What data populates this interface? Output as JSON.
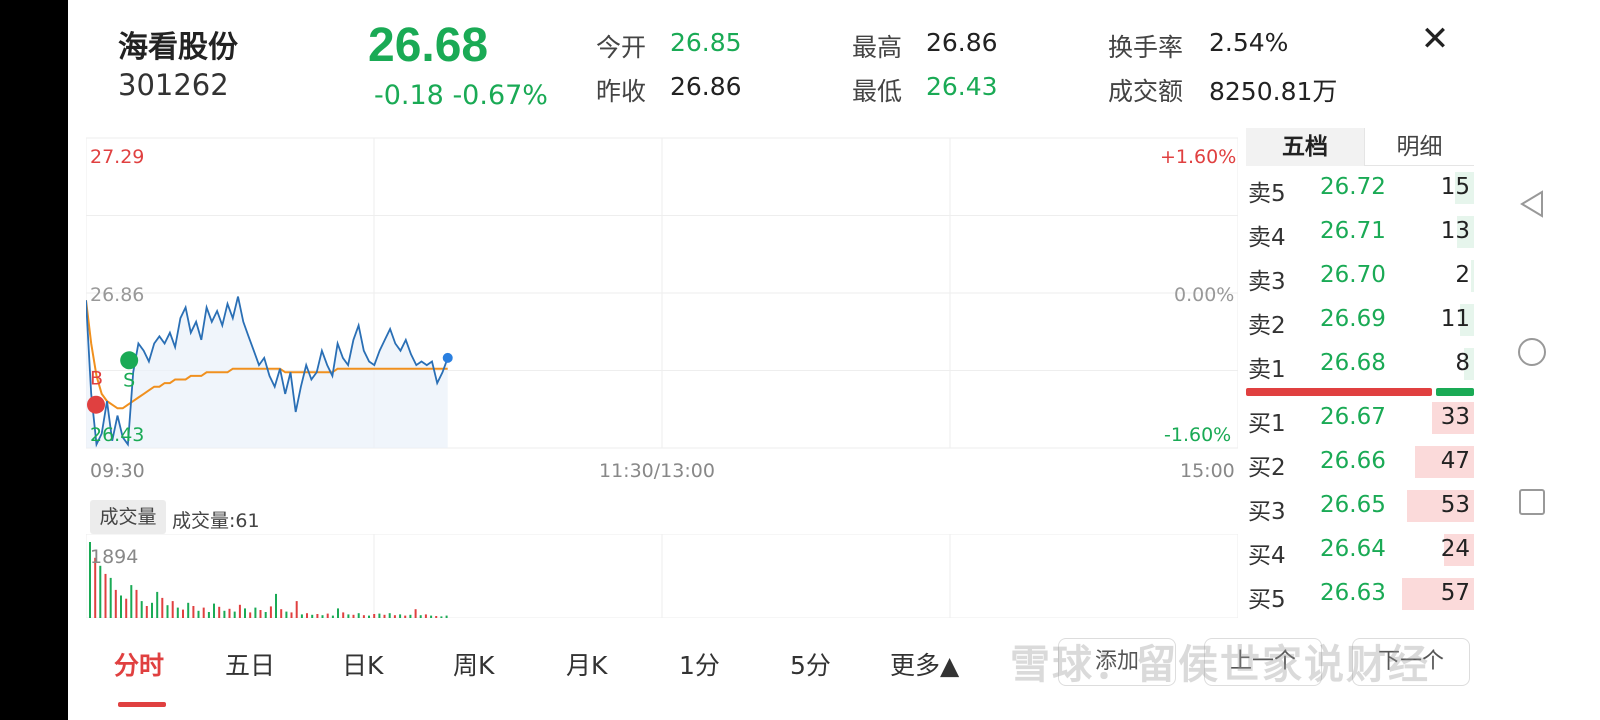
{
  "header": {
    "stock_name": "海看股份",
    "stock_code": "301262",
    "price": "26.68",
    "change": "-0.18 -0.67%",
    "stats": [
      {
        "label": "今开",
        "value": "26.85",
        "color": "#1aaa55"
      },
      {
        "label": "昨收",
        "value": "26.86",
        "color": "#222222"
      },
      {
        "label": "最高",
        "value": "26.86",
        "color": "#222222"
      },
      {
        "label": "最低",
        "value": "26.43",
        "color": "#1aaa55"
      },
      {
        "label": "换手率",
        "value": "2.54%",
        "color": "#222222"
      },
      {
        "label": "成交额",
        "value": "8250.81万",
        "color": "#222222"
      }
    ],
    "close_icon": "close-icon"
  },
  "chart": {
    "y_top_label": "27.29",
    "y_mid_label": "26.86",
    "y_bottom_label": "26.43",
    "pct_top": "+1.60%",
    "pct_mid": "0.00%",
    "pct_bottom": "-1.60%",
    "x_start": "09:30",
    "x_mid": "11:30/13:00",
    "x_end": "15:00",
    "buy_marker": "B",
    "sell_marker": "S",
    "colors": {
      "price_line": "#2a6fb5",
      "avg_line": "#f0901e",
      "up": "#e04040",
      "down": "#1aaa55"
    }
  },
  "chart_data": {
    "type": "line",
    "title": "",
    "xlabel": "",
    "ylabel": "",
    "ylim": [
      26.43,
      27.29
    ],
    "x_range": [
      "09:30",
      "15:00"
    ],
    "series": [
      {
        "values": [
          26.84,
          26.58,
          26.44,
          26.47,
          26.56,
          26.45,
          26.52,
          26.46,
          26.44,
          26.64,
          26.72,
          26.7,
          26.67,
          26.72,
          26.74,
          26.72,
          26.75,
          26.71,
          26.79,
          26.82,
          26.75,
          26.78,
          26.73,
          26.82,
          26.78,
          26.81,
          26.77,
          26.83,
          26.79,
          26.85,
          26.78,
          26.74,
          26.7,
          26.66,
          26.68,
          26.63,
          26.6,
          26.65,
          26.58,
          26.64,
          26.53,
          26.6,
          26.66,
          26.62,
          26.64,
          26.7,
          26.66,
          26.63,
          26.72,
          26.68,
          26.66,
          26.73,
          26.77,
          26.7,
          26.67,
          26.66,
          26.7,
          26.73,
          26.76,
          26.72,
          26.7,
          26.73,
          26.69,
          26.66,
          26.67,
          26.66,
          26.67,
          26.61,
          26.64,
          26.68
        ]
      },
      {
        "values": [
          26.84,
          26.72,
          26.63,
          26.58,
          26.56,
          26.55,
          26.54,
          26.54,
          26.55,
          26.56,
          26.57,
          26.58,
          26.59,
          26.6,
          26.6,
          26.61,
          26.61,
          26.62,
          26.62,
          26.62,
          26.63,
          26.63,
          26.63,
          26.64,
          26.64,
          26.64,
          26.64,
          26.64,
          26.65,
          26.65,
          26.65,
          26.65,
          26.65,
          26.65,
          26.65,
          26.65,
          26.65,
          26.65,
          26.64,
          26.64,
          26.64,
          26.64,
          26.64,
          26.64,
          26.64,
          26.64,
          26.64,
          26.64,
          26.65,
          26.65,
          26.65,
          26.65,
          26.65,
          26.65,
          26.65,
          26.65,
          26.65,
          26.65,
          26.65,
          26.65,
          26.65,
          26.65,
          26.65,
          26.65,
          26.65,
          26.65,
          26.65,
          26.65,
          26.65,
          26.65
        ]
      }
    ],
    "total_minutes": 240,
    "volume": {
      "label": "成交量",
      "info": "成交量:61",
      "max_label": "1894",
      "ylim": [
        0,
        1894
      ],
      "bars": [
        {
          "v": 1894,
          "up": false
        },
        {
          "v": 1500,
          "up": true
        },
        {
          "v": 1300,
          "up": false
        },
        {
          "v": 1100,
          "up": true
        },
        {
          "v": 1000,
          "up": false
        },
        {
          "v": 700,
          "up": true
        },
        {
          "v": 560,
          "up": false
        },
        {
          "v": 480,
          "up": true
        },
        {
          "v": 820,
          "up": false
        },
        {
          "v": 700,
          "up": true
        },
        {
          "v": 420,
          "up": false
        },
        {
          "v": 300,
          "up": true
        },
        {
          "v": 380,
          "up": false
        },
        {
          "v": 650,
          "up": false
        },
        {
          "v": 500,
          "up": true
        },
        {
          "v": 320,
          "up": false
        },
        {
          "v": 420,
          "up": true
        },
        {
          "v": 260,
          "up": false
        },
        {
          "v": 210,
          "up": true
        },
        {
          "v": 380,
          "up": false
        },
        {
          "v": 300,
          "up": true
        },
        {
          "v": 180,
          "up": false
        },
        {
          "v": 260,
          "up": true
        },
        {
          "v": 150,
          "up": false
        },
        {
          "v": 360,
          "up": false
        },
        {
          "v": 280,
          "up": true
        },
        {
          "v": 180,
          "up": false
        },
        {
          "v": 230,
          "up": true
        },
        {
          "v": 160,
          "up": false
        },
        {
          "v": 330,
          "up": true
        },
        {
          "v": 240,
          "up": false
        },
        {
          "v": 140,
          "up": true
        },
        {
          "v": 260,
          "up": false
        },
        {
          "v": 200,
          "up": true
        },
        {
          "v": 150,
          "up": false
        },
        {
          "v": 290,
          "up": true
        },
        {
          "v": 600,
          "up": false
        },
        {
          "v": 220,
          "up": true
        },
        {
          "v": 160,
          "up": false
        },
        {
          "v": 140,
          "up": true
        },
        {
          "v": 420,
          "up": true
        },
        {
          "v": 90,
          "up": false
        },
        {
          "v": 120,
          "up": true
        },
        {
          "v": 80,
          "up": false
        },
        {
          "v": 100,
          "up": true
        },
        {
          "v": 70,
          "up": false
        },
        {
          "v": 110,
          "up": true
        },
        {
          "v": 60,
          "up": false
        },
        {
          "v": 240,
          "up": false
        },
        {
          "v": 140,
          "up": true
        },
        {
          "v": 90,
          "up": false
        },
        {
          "v": 80,
          "up": true
        },
        {
          "v": 120,
          "up": false
        },
        {
          "v": 70,
          "up": true
        },
        {
          "v": 60,
          "up": false
        },
        {
          "v": 100,
          "up": true
        },
        {
          "v": 110,
          "up": false
        },
        {
          "v": 80,
          "up": true
        },
        {
          "v": 120,
          "up": false
        },
        {
          "v": 70,
          "up": true
        },
        {
          "v": 90,
          "up": false
        },
        {
          "v": 60,
          "up": true
        },
        {
          "v": 80,
          "up": false
        },
        {
          "v": 220,
          "up": true
        },
        {
          "v": 70,
          "up": false
        },
        {
          "v": 90,
          "up": true
        },
        {
          "v": 60,
          "up": false
        },
        {
          "v": 50,
          "up": true
        },
        {
          "v": 40,
          "up": false
        },
        {
          "v": 61,
          "up": false
        }
      ]
    }
  },
  "order_book": {
    "tabs": [
      "五档",
      "明细"
    ],
    "asks": [
      {
        "label": "卖5",
        "price": "26.72",
        "vol": "15",
        "share": 0.26
      },
      {
        "label": "卖4",
        "price": "26.71",
        "vol": "13",
        "share": 0.23
      },
      {
        "label": "卖3",
        "price": "26.70",
        "vol": "2",
        "share": 0.04
      },
      {
        "label": "卖2",
        "price": "26.69",
        "vol": "11",
        "share": 0.19
      },
      {
        "label": "卖1",
        "price": "26.68",
        "vol": "8",
        "share": 0.14
      }
    ],
    "bids": [
      {
        "label": "买1",
        "price": "26.67",
        "vol": "33",
        "share": 0.58
      },
      {
        "label": "买2",
        "price": "26.66",
        "vol": "47",
        "share": 0.82
      },
      {
        "label": "买3",
        "price": "26.65",
        "vol": "53",
        "share": 0.93
      },
      {
        "label": "买4",
        "price": "26.64",
        "vol": "24",
        "share": 0.42
      },
      {
        "label": "买5",
        "price": "26.63",
        "vol": "57",
        "share": 1.0
      }
    ],
    "bid_ratio": 0.83,
    "colors": {
      "ask_bg": "#e6f5ec",
      "bid_bg": "#fbdada"
    }
  },
  "tabs": [
    {
      "label": "分时",
      "active": true
    },
    {
      "label": "五日",
      "active": false
    },
    {
      "label": "日K",
      "active": false
    },
    {
      "label": "周K",
      "active": false
    },
    {
      "label": "月K",
      "active": false
    },
    {
      "label": "1分",
      "active": false
    },
    {
      "label": "5分",
      "active": false
    },
    {
      "label": "更多▲",
      "active": false
    }
  ],
  "tab_buttons": [
    "添加",
    "上一个",
    "下一个"
  ],
  "watermark": "雪球：留侯世家说财经",
  "nav": {
    "back_icon": "back-triangle-icon",
    "home_icon": "home-circle-icon",
    "recents_icon": "recents-square-icon"
  }
}
